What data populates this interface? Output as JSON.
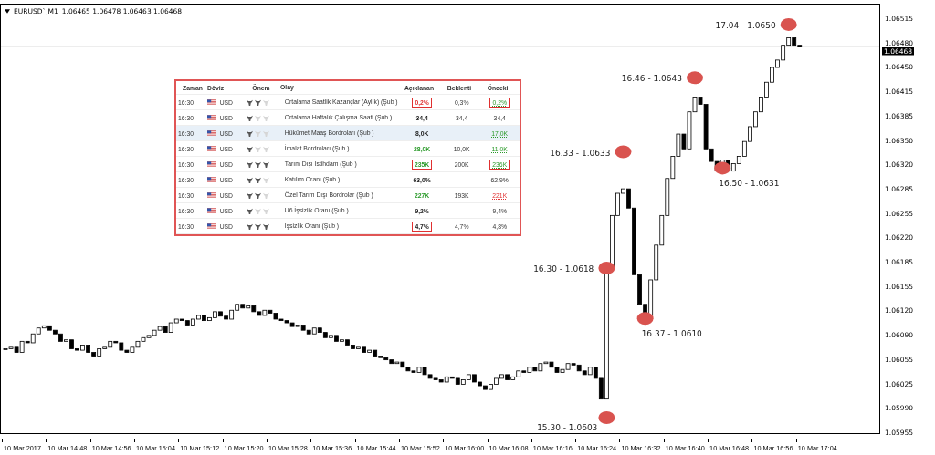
{
  "chart_header": {
    "symbol": "EURUSD`,M1",
    "quotes": "1.06465 1.06478 1.06463 1.06468"
  },
  "price_axis": {
    "labels": [
      "1.06515",
      "1.06480",
      "1.06450",
      "1.06415",
      "1.06385",
      "1.06350",
      "1.06320",
      "1.06285",
      "1.06255",
      "1.06220",
      "1.06185",
      "1.06155",
      "1.06120",
      "1.06090",
      "1.06055",
      "1.06025",
      "1.05990",
      "1.05955"
    ],
    "current_price": "1.06468"
  },
  "time_axis": {
    "labels": [
      "10 Mar 2017",
      "10 Mar 14:48",
      "10 Mar 14:56",
      "10 Mar 15:04",
      "10 Mar 15:12",
      "10 Mar 15:20",
      "10 Mar 15:28",
      "10 Mar 15:36",
      "10 Mar 15:44",
      "10 Mar 15:52",
      "10 Mar 16:00",
      "10 Mar 16:08",
      "10 Mar 16:16",
      "10 Mar 16:24",
      "10 Mar 16:32",
      "10 Mar 16:40",
      "10 Mar 16:48",
      "10 Mar 16:56",
      "10 Mar 17:04"
    ]
  },
  "chart_notes": [
    "17.04 - 1.0650",
    "16.46 - 1.0643",
    "16.33 - 1.0633",
    "16.50 - 1.0631",
    "16.30 - 1.0618",
    "16.37 - 1.0610",
    "15.30 - 1.0603"
  ],
  "calendar": {
    "columns": [
      "Zaman",
      "Döviz",
      "Önem",
      "Olay",
      "Açıklanan",
      "Beklenti",
      "Önceki"
    ],
    "rows": [
      {
        "time": "16:30",
        "currency": "USD",
        "stars": 2,
        "event": "Ortalama Saatlik Kazançlar (Aylık) (Şub )",
        "actual": {
          "text": "0,2%",
          "positive": false,
          "negative": true,
          "highlighted": true
        },
        "forecast": "0,3%",
        "previous": {
          "text": "0,2%",
          "positive": true,
          "negative": false,
          "revised": true,
          "highlighted": true
        },
        "selected": false
      },
      {
        "time": "16:30",
        "currency": "USD",
        "stars": 1,
        "event": "Ortalama Haftalık Çalışma Saati (Şub )",
        "actual": {
          "text": "34,4",
          "positive": false,
          "negative": false,
          "highlighted": false
        },
        "forecast": "34,4",
        "previous": {
          "text": "34,4",
          "positive": false,
          "negative": false,
          "revised": false,
          "highlighted": false
        },
        "selected": false
      },
      {
        "time": "16:30",
        "currency": "USD",
        "stars": 1,
        "event": "Hükümet Maaş Bordroları (Şub )",
        "actual": {
          "text": "8,0K",
          "positive": false,
          "negative": false,
          "highlighted": false
        },
        "previous": {
          "text": "17,0K",
          "positive": true,
          "negative": false,
          "revised": true,
          "highlighted": false
        },
        "selected": true
      },
      {
        "time": "16:30",
        "currency": "USD",
        "stars": 1,
        "event": "İmalat Bordroları (Şub )",
        "actual": {
          "text": "28,0K",
          "positive": true,
          "negative": false,
          "highlighted": false
        },
        "forecast": "10,0K",
        "previous": {
          "text": "11,0K",
          "positive": true,
          "negative": false,
          "revised": true,
          "highlighted": false
        },
        "selected": false
      },
      {
        "time": "16:30",
        "currency": "USD",
        "stars": 3,
        "event": "Tarım Dışı İstihdam (Şub )",
        "actual": {
          "text": "235K",
          "positive": true,
          "negative": false,
          "highlighted": true
        },
        "forecast": "200K",
        "previous": {
          "text": "236K",
          "positive": true,
          "negative": false,
          "revised": true,
          "highlighted": true
        },
        "selected": false
      },
      {
        "time": "16:30",
        "currency": "USD",
        "stars": 2,
        "event": "Katılım Oranı (Şub )",
        "actual": {
          "text": "63,0%",
          "positive": false,
          "negative": false,
          "highlighted": false
        },
        "previous": {
          "text": "62,9%",
          "positive": false,
          "negative": false,
          "revised": false,
          "highlighted": false
        },
        "selected": false
      },
      {
        "time": "16:30",
        "currency": "USD",
        "stars": 2,
        "event": "Özel Tarım Dışı Bordrolar (Şub )",
        "actual": {
          "text": "227K",
          "positive": true,
          "negative": false,
          "highlighted": false
        },
        "forecast": "193K",
        "previous": {
          "text": "221K",
          "positive": false,
          "negative": true,
          "revised": true,
          "highlighted": false
        },
        "selected": false
      },
      {
        "time": "16:30",
        "currency": "USD",
        "stars": 1,
        "event": "U6 İşsizlik Oranı (Şub )",
        "actual": {
          "text": "9,2%",
          "positive": false,
          "negative": false,
          "highlighted": false
        },
        "previous": {
          "text": "9,4%",
          "positive": false,
          "negative": false,
          "revised": false,
          "highlighted": false
        },
        "selected": false
      },
      {
        "time": "16:30",
        "currency": "USD",
        "stars": 3,
        "event": "İşsizlik Oranı (Şub )",
        "actual": {
          "text": "4,7%",
          "positive": false,
          "negative": false,
          "highlighted": true
        },
        "forecast": "4,7%",
        "previous": {
          "text": "4,8%",
          "positive": false,
          "negative": false,
          "revised": false,
          "highlighted": false
        },
        "selected": false
      }
    ]
  }
}
